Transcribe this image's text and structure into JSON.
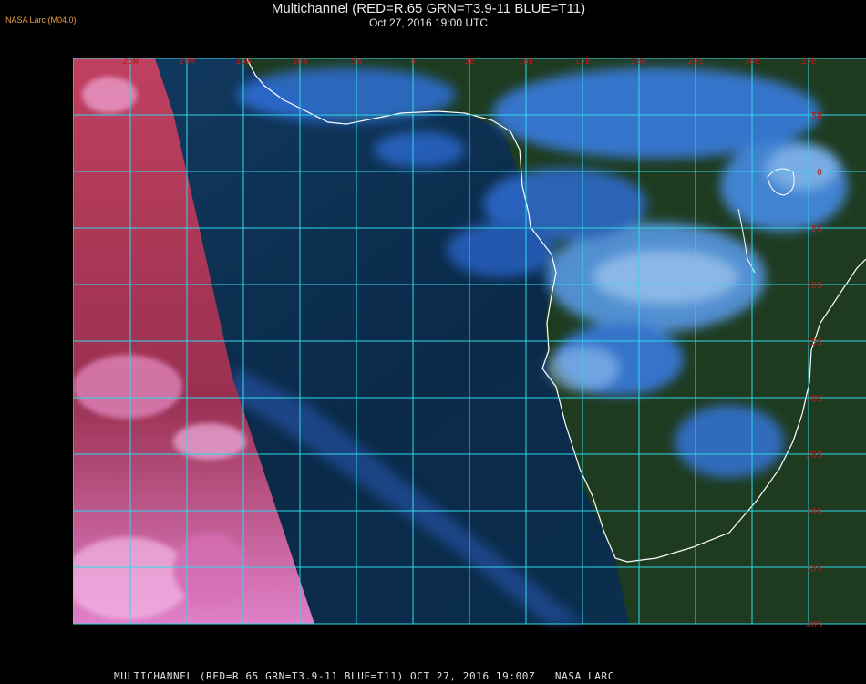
{
  "header": {
    "source_tag": "NASA Larc (M04.0)",
    "title": "Multichannel (RED=R.65 GRN=T3.9-11 BLUE=T11)",
    "subtitle": "Oct 27, 2016 19:00 UTC"
  },
  "map": {
    "region": "South Atlantic / Southern Africa",
    "lon_labels": [
      "25W",
      "20W",
      "15W",
      "10W",
      "5W",
      "0",
      "5E",
      "10E",
      "15E",
      "20E",
      "25E",
      "30E",
      "35E"
    ],
    "lat_labels": [
      "5N",
      "0",
      "5S",
      "10S",
      "15S",
      "20S",
      "25S",
      "30S",
      "35S",
      "40S"
    ],
    "colors": {
      "grid": "#30d8e8",
      "coast": "#ffffff",
      "ocean": "#0a2a48",
      "land": "#1f3f22",
      "cloud_blue": "#3a7ee8",
      "cloud_light": "#9fcaf5",
      "daylight_red": "#d24d78",
      "daylight_pink": "#f0a0d8"
    }
  },
  "footer": {
    "text": "MULTICHANNEL (RED=R.65 GRN=T3.9-11 BLUE=T11) OCT 27, 2016 19:00Z   NASA LARC"
  }
}
